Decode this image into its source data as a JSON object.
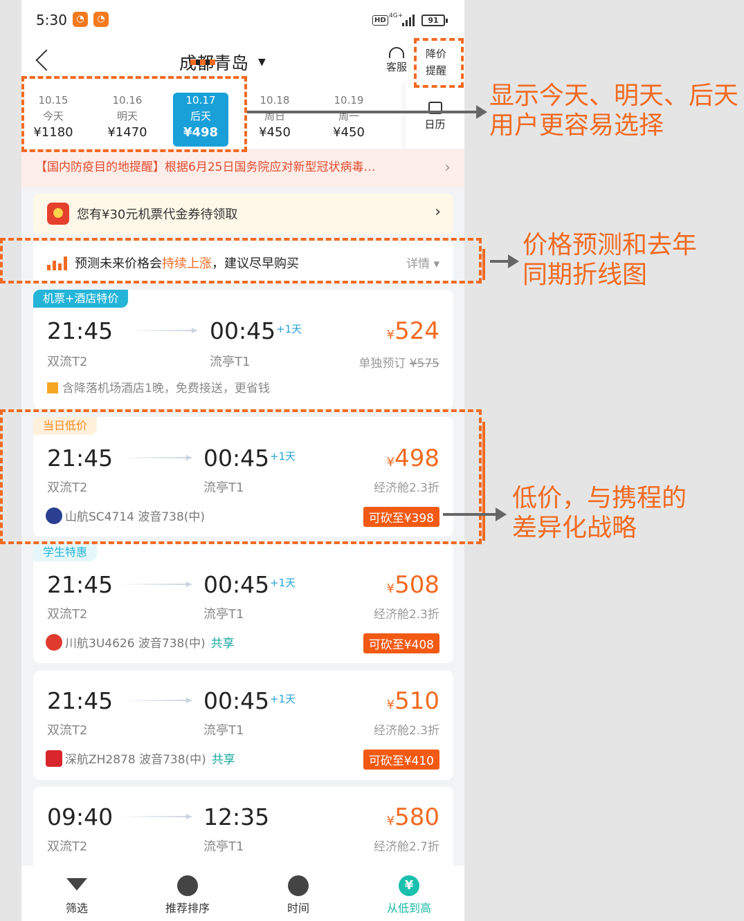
{
  "status": {
    "time": "5:30",
    "hd": "HD",
    "net": "4G+",
    "battery": "91"
  },
  "header": {
    "from": "成都",
    "to": "青岛",
    "service": "客服",
    "alert_line1": "降价",
    "alert_line2": "提醒"
  },
  "dates": [
    {
      "date": "10.15",
      "day": "今天",
      "price": "¥1180"
    },
    {
      "date": "10.16",
      "day": "明天",
      "price": "¥1470"
    },
    {
      "date": "10.17",
      "day": "后天",
      "price": "¥498",
      "selected": true
    },
    {
      "date": "10.18",
      "day": "周日",
      "price": "¥450"
    },
    {
      "date": "10.19",
      "day": "周一",
      "price": "¥450"
    }
  ],
  "calendar_label": "日历",
  "notice": "【国内防疫目的地提醒】根据6月25日国务院应对新型冠状病毒…",
  "coupon": "您有¥30元机票代金券待领取",
  "predict": {
    "pre": "预测未来价格会",
    "highlight": "持续上涨",
    "post": "，建议尽早购买",
    "detail": "详情 ▾"
  },
  "flights": [
    {
      "tag": "机票+酒店特价",
      "dep": "21:45",
      "arr": "00:45",
      "plus": "+1天",
      "dep_term": "双流T2",
      "arr_term": "流亭T1",
      "price": "524",
      "sub_pre": "单独预订 ",
      "sub_strike": "¥575",
      "hotel": "含降落机场酒店1晚，免费接送，更省钱"
    },
    {
      "tag": "当日低价",
      "dep": "21:45",
      "arr": "00:45",
      "plus": "+1天",
      "dep_term": "双流T2",
      "arr_term": "流亭T1",
      "price": "498",
      "sub": "经济舱2.3折",
      "airline": "山航SC4714  波音738(中)",
      "cut": "可砍至¥398"
    },
    {
      "tag": "学生特惠",
      "dep": "21:45",
      "arr": "00:45",
      "plus": "+1天",
      "dep_term": "双流T2",
      "arr_term": "流亭T1",
      "price": "508",
      "sub": "经济舱2.3折",
      "airline": "川航3U4626  波音738(中)",
      "share": "共享",
      "cut": "可砍至¥408"
    },
    {
      "dep": "21:45",
      "arr": "00:45",
      "plus": "+1天",
      "dep_term": "双流T2",
      "arr_term": "流亭T1",
      "price": "510",
      "sub": "经济舱2.3折",
      "airline": "深航ZH2878  波音738(中)",
      "share": "共享",
      "cut": "可砍至¥410"
    },
    {
      "dep": "09:40",
      "arr": "12:35",
      "dep_term": "双流T2",
      "arr_term": "流亭T1",
      "price": "580",
      "sub": "经济舱2.7折"
    }
  ],
  "currency": "¥",
  "tabs": [
    {
      "label": "筛选"
    },
    {
      "label": "推荐排序"
    },
    {
      "label": "时间"
    },
    {
      "label": "从低到高",
      "icon": "¥"
    }
  ],
  "annotations": {
    "a1_line1": "显示今天、明天、后天",
    "a1_line2": "用户更容易选择",
    "a2_line1": "价格预测和去年",
    "a2_line2": "同期折线图",
    "a3_line1": "低价，与携程的",
    "a3_line2": "差异化战略"
  },
  "colors": {
    "accent": "#f26a21",
    "selected_date": "#1aa0d8",
    "teal": "#19c0ad"
  }
}
